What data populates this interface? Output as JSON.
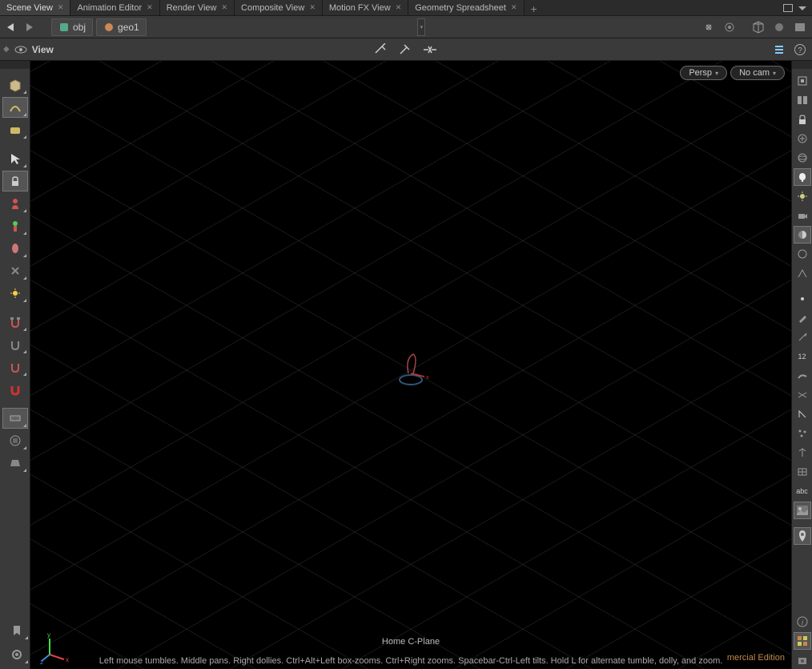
{
  "tabs": {
    "items": [
      {
        "label": "Scene View",
        "active": true
      },
      {
        "label": "Animation Editor",
        "active": false
      },
      {
        "label": "Render View",
        "active": false
      },
      {
        "label": "Composite View",
        "active": false
      },
      {
        "label": "Motion FX View",
        "active": false
      },
      {
        "label": "Geometry Spreadsheet",
        "active": false
      }
    ]
  },
  "path": {
    "segments": [
      {
        "label": "obj",
        "iconColor": "#7aa"
      },
      {
        "label": "geo1",
        "iconColor": "#c80"
      }
    ]
  },
  "viewHeader": {
    "title": "View"
  },
  "viewport": {
    "cameraMenu": "Persp",
    "camSelect": "No cam",
    "cplaneLabel": "Home C-Plane",
    "hint": "Left mouse tumbles. Middle pans. Right dollies. Ctrl+Alt+Left box-zooms. Ctrl+Right zooms. Spacebar-Ctrl-Left tilts. Hold L for alternate tumble, dolly, and zoom.",
    "watermark": "mercial Edition"
  },
  "rightToolbar": {
    "abcLabel": "abc",
    "numLabel": "12"
  }
}
